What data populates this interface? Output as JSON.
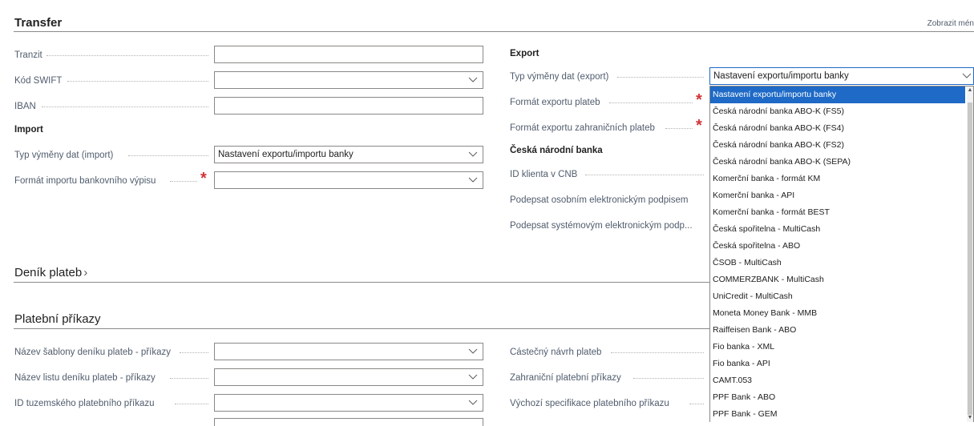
{
  "transfer": {
    "title": "Transfer",
    "show_more": "Zobrazit mén",
    "tranzit_label": "Tranzit",
    "tranzit_value": "",
    "swift_label": "Kód SWIFT",
    "swift_value": "",
    "iban_label": "IBAN",
    "iban_value": "",
    "import": {
      "heading": "Import",
      "exchange_type_label": "Typ výměny dat (import)",
      "exchange_type_value": "Nastavení exportu/importu banky",
      "statement_format_label": "Formát importu bankovního výpisu",
      "statement_format_value": ""
    },
    "export": {
      "heading": "Export",
      "exchange_type_label": "Typ výměny dat (export)",
      "exchange_type_value": "Nastavení exportu/importu banky",
      "payment_format_label": "Formát exportu plateb",
      "foreign_payment_format_label": "Formát exportu zahraničních plateb"
    },
    "cnb": {
      "heading": "Česká národní banka",
      "client_id_label": "ID klienta v ČNB",
      "personal_sign_label": "Podepsat osobním elektronickým podpisem",
      "system_sign_label": "Podepsat systémovým elektronickým podp..."
    }
  },
  "payment_journal": {
    "title": "Deník plateb",
    "chevron": "›"
  },
  "payment_orders": {
    "title": "Platební příkazy",
    "template_label": "Název šablony deníku plateb - příkazy",
    "batch_label": "Název listu deníku plateb - příkazy",
    "domestic_id_label": "ID tuzemského platebního příkazu",
    "partial_label": "Částečný návrh plateb",
    "foreign_label": "Zahraniční platební příkazy",
    "default_spec_label": "Výchozí specifikace platebního příkazu"
  },
  "dropdown": {
    "options": [
      "Nastavení exportu/importu banky",
      "Česká národní banka ABO-K (FS5)",
      "Česká národní banka ABO-K (FS4)",
      "Česká národní banka ABO-K (FS2)",
      "Česká národní banka ABO-K (SEPA)",
      "Komerční banka - formát KM",
      "Komerční banka - API",
      "Komerční banka - formát BEST",
      "Česká spořitelna - MultiCash",
      "Česká spořitelna - ABO",
      "ČSOB - MultiCash",
      "COMMERZBANK - MultiCash",
      "UniCredit - MultiCash",
      "Moneta Money Bank - MMB",
      "Raiffeisen Bank - ABO",
      "Fio banka - XML",
      "Fio banka - API",
      "CAMT.053",
      "PPF Bank - ABO",
      "PPF Bank - GEM"
    ],
    "selected_index": 0
  },
  "colors": {
    "accent": "#1e6ac6",
    "required": "#d13438"
  }
}
